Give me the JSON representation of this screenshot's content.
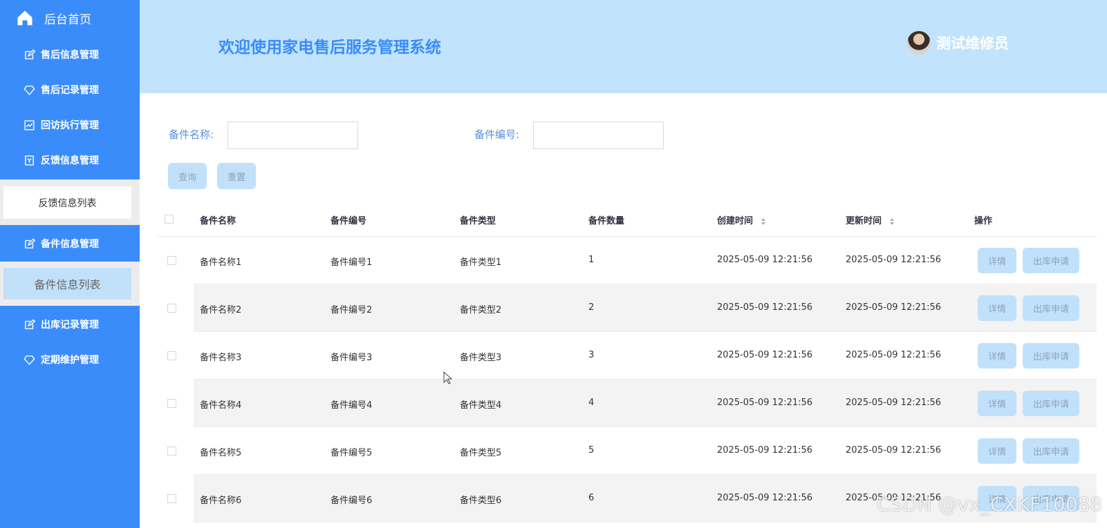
{
  "sidebar": {
    "home_label": "后台首页",
    "items": [
      {
        "label": "售后信息管理",
        "icon": "edit-icon"
      },
      {
        "label": "售后记录管理",
        "icon": "diamond-icon"
      },
      {
        "label": "回访执行管理",
        "icon": "chart-icon"
      },
      {
        "label": "反馈信息管理",
        "icon": "document-icon"
      },
      {
        "label": "备件信息管理",
        "icon": "edit-icon"
      },
      {
        "label": "出库记录管理",
        "icon": "edit-icon"
      },
      {
        "label": "定期维护管理",
        "icon": "diamond-icon"
      }
    ],
    "sub_feedback": "反馈信息列表",
    "sub_parts": "备件信息列表"
  },
  "header": {
    "title": "欢迎使用家电售后服务管理系统",
    "user_name": "测试维修员"
  },
  "search": {
    "name_label": "备件名称:",
    "code_label": "备件编号:",
    "query_label": "查询",
    "reset_label": "重置"
  },
  "table": {
    "headers": [
      "备件名称",
      "备件编号",
      "备件类型",
      "备件数量",
      "创建时间",
      "更新时间",
      "操作"
    ],
    "rows": [
      {
        "name": "备件名称1",
        "code": "备件编号1",
        "type": "备件类型1",
        "qty": "1",
        "created": "2025-05-09 12:21:56",
        "updated": "2025-05-09 12:21:56"
      },
      {
        "name": "备件名称2",
        "code": "备件编号2",
        "type": "备件类型2",
        "qty": "2",
        "created": "2025-05-09 12:21:56",
        "updated": "2025-05-09 12:21:56"
      },
      {
        "name": "备件名称3",
        "code": "备件编号3",
        "type": "备件类型3",
        "qty": "3",
        "created": "2025-05-09 12:21:56",
        "updated": "2025-05-09 12:21:56"
      },
      {
        "name": "备件名称4",
        "code": "备件编号4",
        "type": "备件类型4",
        "qty": "4",
        "created": "2025-05-09 12:21:56",
        "updated": "2025-05-09 12:21:56"
      },
      {
        "name": "备件名称5",
        "code": "备件编号5",
        "type": "备件类型5",
        "qty": "5",
        "created": "2025-05-09 12:21:56",
        "updated": "2025-05-09 12:21:56"
      },
      {
        "name": "备件名称6",
        "code": "备件编号6",
        "type": "备件类型6",
        "qty": "6",
        "created": "2025-05-09 12:21:56",
        "updated": "2025-05-09 12:21:56"
      }
    ],
    "detail_label": "详情",
    "outbound_label": "出库申请"
  },
  "watermark": "CSDN @vx_CXKF10088",
  "colors": {
    "sidebar": "#3a8cfa",
    "header": "#c1e3fb",
    "button": "#c1e1fb"
  }
}
